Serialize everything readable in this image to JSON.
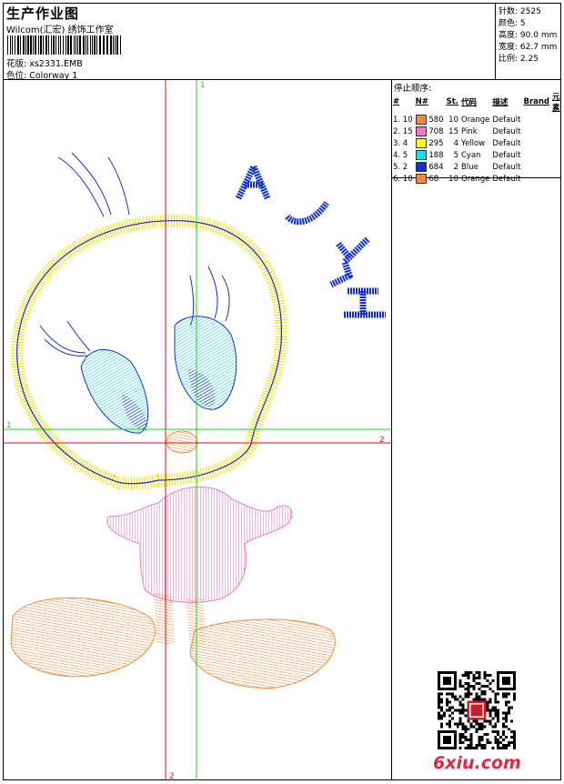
{
  "header": {
    "title": "生产作业图",
    "subtitle": "Wilcom(汇宏) 绣饰工作室",
    "pattern_label": "花版:",
    "pattern_value": "xs2331.EMB",
    "colorway_label": "色位:",
    "colorway_value": "Colorway 1"
  },
  "stats": [
    {
      "label": "针数:",
      "value": "2525"
    },
    {
      "label": "颜色:",
      "value": "5"
    },
    {
      "label": "高度:",
      "value": "90.0 mm"
    },
    {
      "label": "宽度:",
      "value": "62.7 mm"
    },
    {
      "label": "比例:",
      "value": "2.25"
    }
  ],
  "stop_sequence": {
    "title": "停止顺序:",
    "columns": [
      "#",
      "N#",
      "St.",
      "代码",
      "描述",
      "Brand",
      "元素"
    ],
    "rows": [
      {
        "idx": "1. 10",
        "color": "#f08a3c",
        "st": "580",
        "code": "10",
        "desc": "Orange",
        "brand": "Default"
      },
      {
        "idx": "2. 15",
        "color": "#f07ac0",
        "st": "708",
        "code": "15",
        "desc": "Pink",
        "brand": "Default"
      },
      {
        "idx": "3. 4",
        "color": "#ffff00",
        "st": "295",
        "code": "4",
        "desc": "Yellow",
        "brand": "Default"
      },
      {
        "idx": "4. 5",
        "color": "#22dddd",
        "st": "188",
        "code": "5",
        "desc": "Cyan",
        "brand": "Default"
      },
      {
        "idx": "5. 2",
        "color": "#1030d0",
        "st": "684",
        "code": "2",
        "desc": "Blue",
        "brand": "Default"
      },
      {
        "idx": "6. 10",
        "color": "#f08a3c",
        "st": "68",
        "code": "10",
        "desc": "Orange",
        "brand": "Default"
      }
    ]
  },
  "canvas": {
    "guide_v_red_label": "2",
    "guide_v_green_label": "1",
    "guide_h_green_label": "1",
    "guide_h_red_label": "2",
    "embroidery_text": "AJJY"
  },
  "watermark": "6xiu.com"
}
